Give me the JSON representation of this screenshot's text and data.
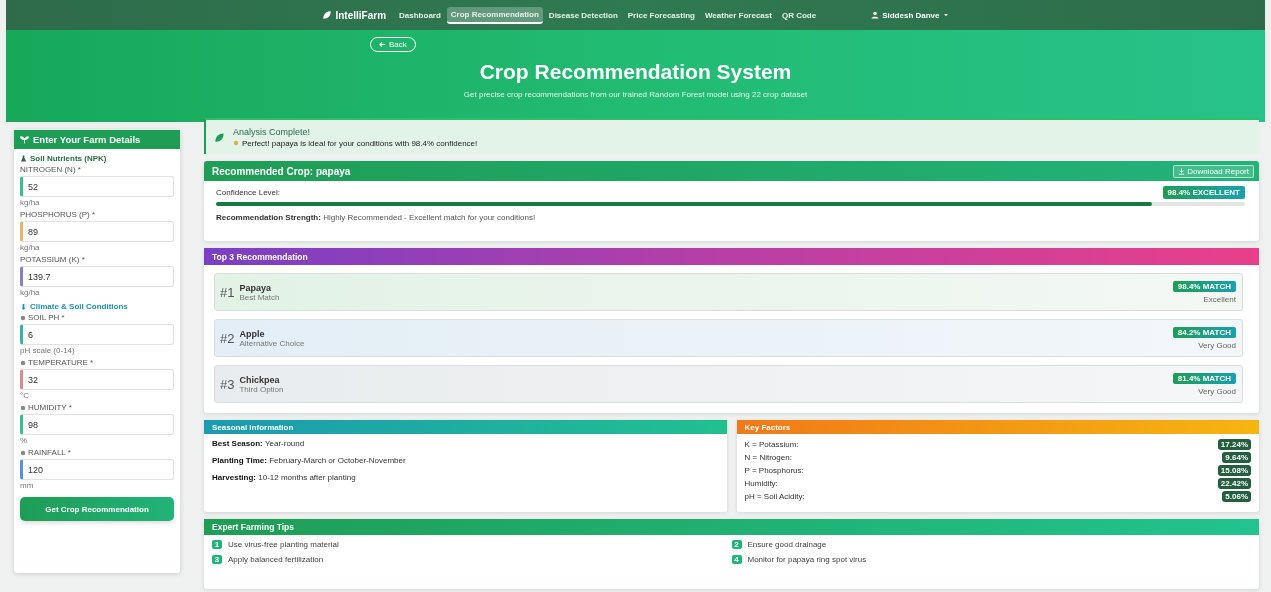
{
  "nav": {
    "brand": "IntelliFarm",
    "items": [
      {
        "label": "Dashboard",
        "selected": false
      },
      {
        "label": "Crop Recommendation",
        "selected": true
      },
      {
        "label": "Disease Detection",
        "selected": false
      },
      {
        "label": "Price Forecasting",
        "selected": false
      },
      {
        "label": "Weather Forecast",
        "selected": false
      },
      {
        "label": "QR Code",
        "selected": false
      }
    ],
    "user": "Siddesh Danve"
  },
  "hero": {
    "back": "Back",
    "title": "Crop Recommendation System",
    "subtitle": "Get precise crop recommendations from our trained Random Forest model using 22 crop dataset"
  },
  "form": {
    "title": "Enter Your Farm Details",
    "sections": [
      {
        "title": "Soil Nutrients (NPK)",
        "kind": "soil",
        "fields": [
          {
            "label": "NITROGEN (N) *",
            "value": "52",
            "unit": "kg/ha"
          },
          {
            "label": "PHOSPHORUS (P) *",
            "value": "89",
            "unit": "kg/ha"
          },
          {
            "label": "POTASSIUM (K) *",
            "value": "139.7",
            "unit": "kg/ha"
          }
        ]
      },
      {
        "title": "Climate & Soil Conditions",
        "kind": "climate",
        "fields": [
          {
            "label": "SOIL PH *",
            "value": "6",
            "unit": "pH scale (0-14)"
          },
          {
            "label": "TEMPERATURE *",
            "value": "32",
            "unit": "°C"
          },
          {
            "label": "HUMIDITY *",
            "value": "98",
            "unit": "%"
          },
          {
            "label": "RAINFALL *",
            "value": "120",
            "unit": "mm"
          }
        ]
      }
    ],
    "button": "Get Crop Recommendation"
  },
  "alert": {
    "title": "Analysis Complete!",
    "message": "Perfect! papaya is ideal for your conditions with 98.4% confidence!"
  },
  "recommended": {
    "title": "Recommended Crop: papaya",
    "download": "Download Report",
    "confidence_label": "Confidence Level:",
    "badge": "98.4% EXCELLENT",
    "level": 0.91,
    "strength_label": "Recommendation Strength:",
    "strength": "Highly Recommended - Excellent match for your conditions!"
  },
  "top3": {
    "title": "Top 3 Recommendation",
    "items": [
      {
        "rank": "#1",
        "name": "Papaya",
        "subtitle": "Best Match",
        "match": "98.4% MATCH",
        "quality": "Excellent"
      },
      {
        "rank": "#2",
        "name": "Apple",
        "subtitle": "Alternative Choice",
        "match": "84.2% MATCH",
        "quality": "Very Good"
      },
      {
        "rank": "#3",
        "name": "Chickpea",
        "subtitle": "Third Option",
        "match": "81.4% MATCH",
        "quality": "Very Good"
      }
    ]
  },
  "seasonal": {
    "title": "Seasonal Information",
    "rows": [
      {
        "label": "Best Season:",
        "value": "Year-round"
      },
      {
        "label": "Planting Time:",
        "value": "February-March or October-November"
      },
      {
        "label": "Harvesting:",
        "value": "10-12 months after planting"
      }
    ]
  },
  "factors": {
    "title": "Key Factors",
    "rows": [
      {
        "label": "K = Potassium:",
        "value": "17.24%"
      },
      {
        "label": "N = Nitrogen:",
        "value": "9.64%"
      },
      {
        "label": "P = Phosphorus:",
        "value": "15.08%"
      },
      {
        "label": "Humidity:",
        "value": "22.42%"
      },
      {
        "label": "pH = Soil Acidity:",
        "value": "5.06%"
      }
    ]
  },
  "tips": {
    "title": "Expert Farming Tips",
    "items": [
      {
        "number": "1",
        "text": "Use virus-free planting material"
      },
      {
        "number": "2",
        "text": "Ensure good drainage"
      },
      {
        "number": "3",
        "text": "Apply balanced fertilization"
      },
      {
        "number": "4",
        "text": "Monitor for papaya ring spot virus"
      }
    ]
  }
}
